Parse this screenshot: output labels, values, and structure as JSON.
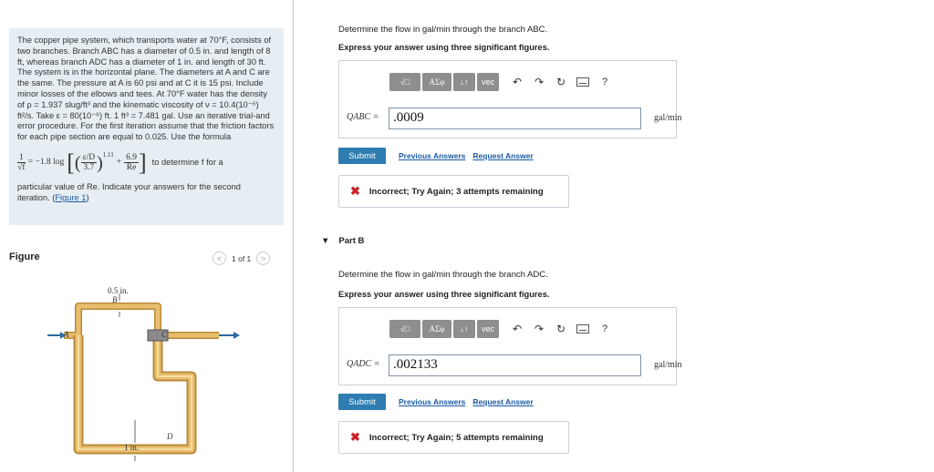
{
  "problem": {
    "text_1": "The copper pipe system, which transports water at 70°F, consists of two branches. Branch ABC has a diameter of 0.5 in. and length of 8 ft, whereas branch ADC has a diameter of 1 in. and length of 30 ft. The system is in the horizontal plane. The diameters at A and C are the same. The pressure at A is 60 psi and at C it is 15 psi. Include minor losses of the elbows and tees. At 70°F water has the density of ρ = 1.937 slug/ft³ and the kinematic viscosity of ν = 10.4(10⁻⁶) ft²/s. Take ε = 80(10⁻⁶) ft. 1 ft³ = 7.481 gal. Use an iterative trial-and error procedure. For the first iteration assume that the friction factors for each pipe section are equal to 0.025. Use the formula",
    "formula_lhs": "1",
    "formula_lhs_den": "√f",
    "formula_eq": "= −1.8 log",
    "formula_eps": "ε/D",
    "formula_37": "3.7",
    "formula_exp": "1.11",
    "formula_plus": "+",
    "formula_69": "6.9",
    "formula_re": "Re",
    "formula_tail": "to determine f for a",
    "text_2": "particular value of Re. Indicate your answers for the second iteration. (",
    "figure_link": "Figure 1",
    "text_3": ")"
  },
  "figure": {
    "label": "Figure",
    "pager": "1 of 1",
    "labels": {
      "top_dim": "0.5 in.",
      "B": "B",
      "A": "A",
      "C": "C",
      "D": "D",
      "bottom_dim": "1 in."
    }
  },
  "partA": {
    "question": "Determine the flow in gal/min through the branch ABC.",
    "instruction": "Express your answer using three significant figures.",
    "toolbar": [
      "√□",
      "ΑΣφ",
      "↓↑",
      "vec"
    ],
    "help": "?",
    "answer_label": "QABC =",
    "answer_value": ".0009",
    "unit": "gal/min",
    "submit": "Submit",
    "previous": "Previous Answers",
    "request": "Request Answer",
    "feedback": "Incorrect; Try Again; 3 attempts remaining"
  },
  "partB": {
    "header": "Part B",
    "question": "Determine the flow in gal/min through the branch ADC.",
    "instruction": "Express your answer using three significant figures.",
    "toolbar": [
      "√□",
      "ΑΣφ",
      "↓↑",
      "vec"
    ],
    "help": "?",
    "answer_label": "QADC =",
    "answer_value": ".002133",
    "unit": "gal/min",
    "submit": "Submit",
    "previous": "Previous Answers",
    "request": "Request Answer",
    "feedback": "Incorrect; Try Again; 5 attempts remaining"
  },
  "colors": {
    "problem_bg": "#e6eef3",
    "submit": "#2e7cb0",
    "link": "#1a5aa6",
    "error": "#c92026",
    "pipe": "#d9a64f"
  }
}
